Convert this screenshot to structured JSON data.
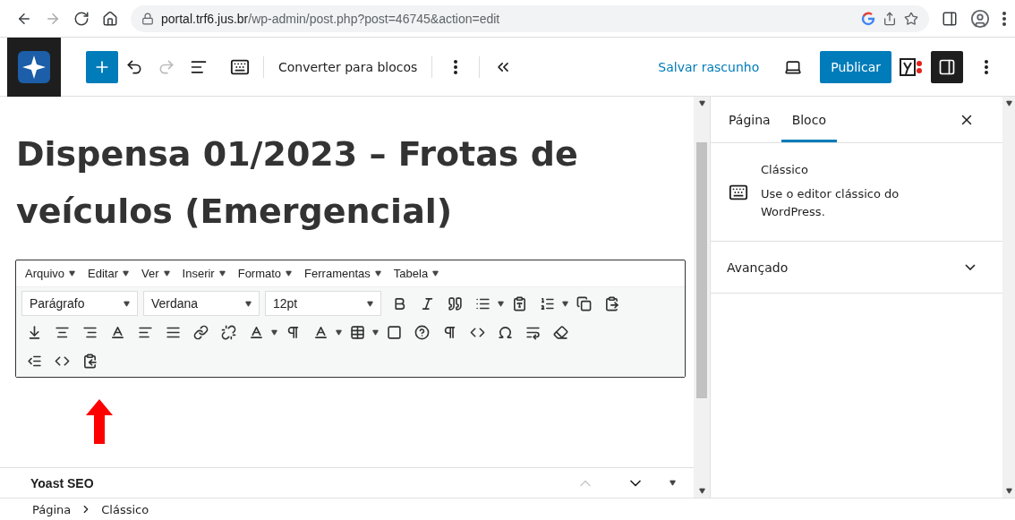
{
  "browser": {
    "url_host": "portal.trf6.jus.br",
    "url_path": "/wp-admin/post.php?post=46745&action=edit"
  },
  "header": {
    "convert_label": "Converter para blocos",
    "save_draft": "Salvar rascunho",
    "publish": "Publicar",
    "redo_disabled": true
  },
  "title": "Dispensa 01/2023 – Frotas de veículos (Emergencial)",
  "classic_editor": {
    "menus": [
      "Arquivo",
      "Editar",
      "Ver",
      "Inserir",
      "Formato",
      "Ferramentas",
      "Tabela"
    ],
    "selects": [
      {
        "value": "Parágrafo"
      },
      {
        "value": "Verdana"
      },
      {
        "value": "12pt"
      }
    ]
  },
  "yoast": {
    "label": "Yoast SEO",
    "up_disabled": true
  },
  "sidebar": {
    "tabs": [
      {
        "label": "Página",
        "selected": false
      },
      {
        "label": "Bloco",
        "selected": true
      }
    ],
    "block": {
      "name": "Clássico",
      "description": "Use o editor clássico do WordPress."
    },
    "sections": [
      {
        "label": "Avançado",
        "expanded": false
      }
    ]
  },
  "breadcrumb": [
    "Página",
    "Clássico"
  ]
}
